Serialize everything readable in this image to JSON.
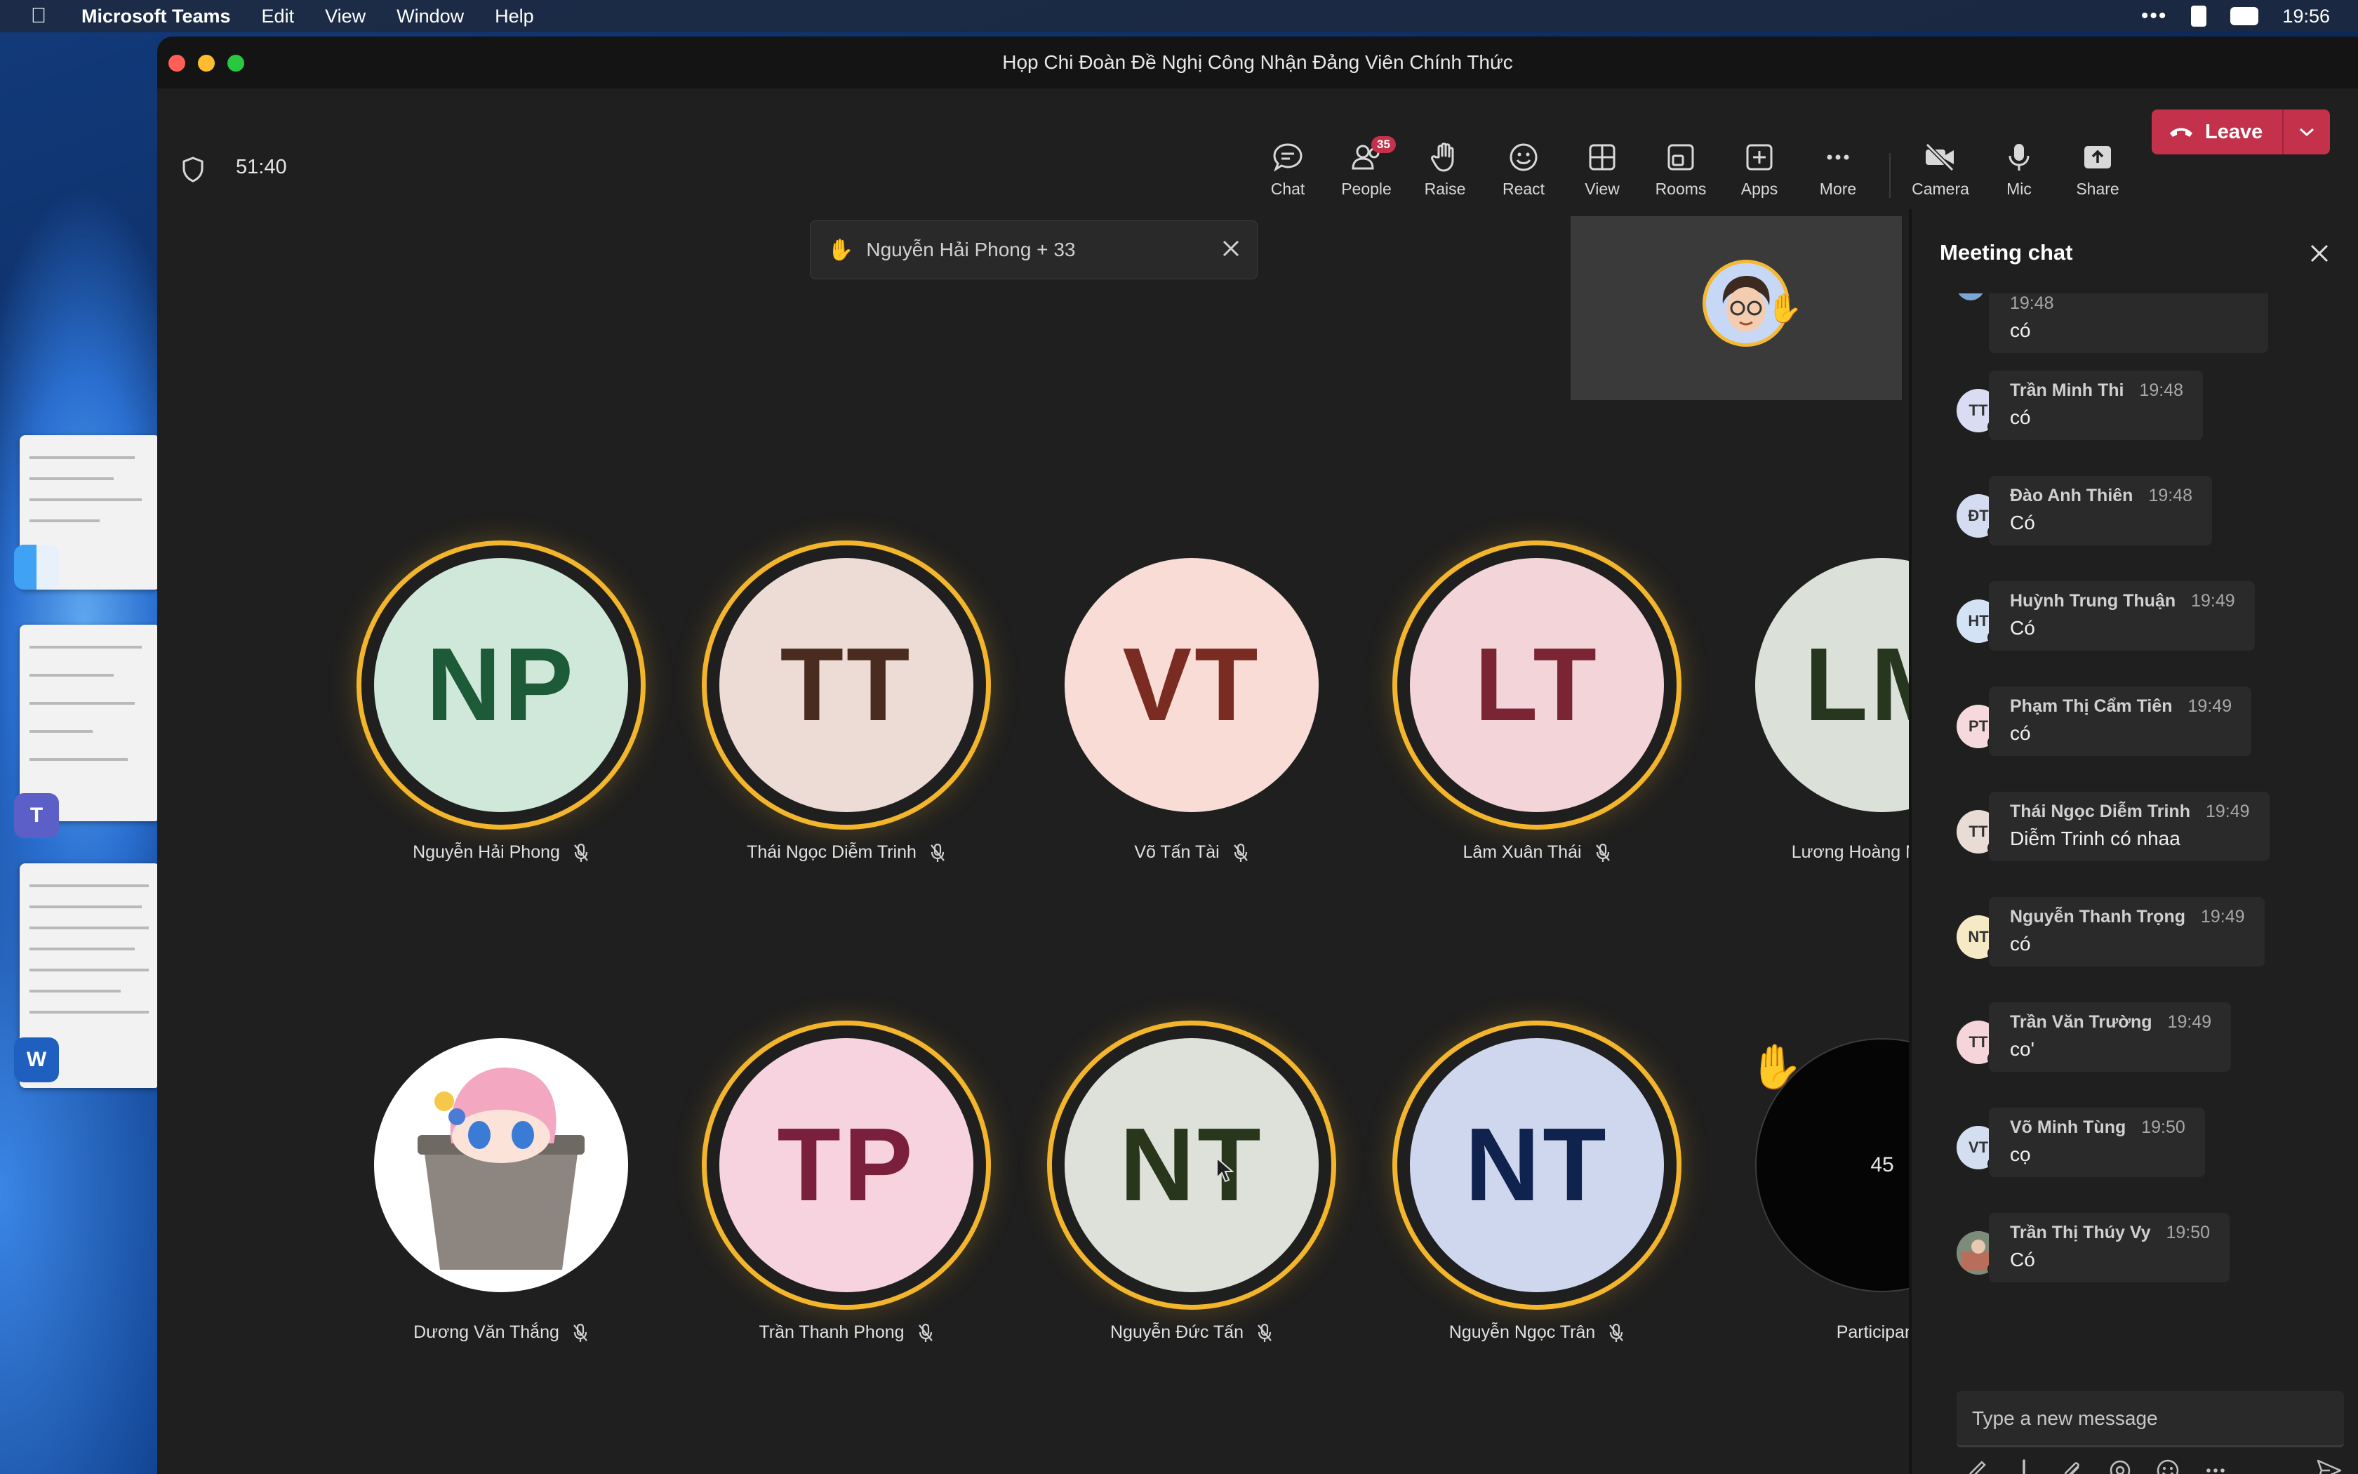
{
  "menubar": {
    "app_name": "Microsoft Teams",
    "menus": [
      "Edit",
      "View",
      "Window",
      "Help"
    ],
    "clock": "19:56"
  },
  "window": {
    "title": "Họp Chi Đoàn Đề Nghị Công Nhận Đảng Viên Chính Thức"
  },
  "toolbar": {
    "timer": "51:40",
    "chat": "Chat",
    "people": "People",
    "people_badge": "35",
    "raise": "Raise",
    "react": "React",
    "view": "View",
    "rooms": "Rooms",
    "apps": "Apps",
    "more": "More",
    "camera": "Camera",
    "mic": "Mic",
    "share": "Share",
    "leave": "Leave"
  },
  "stage": {
    "raised_hand_banner": "Nguyễn Hải Phong + 33",
    "participants_count": "45",
    "participants_label": "Participants",
    "tiles": [
      {
        "initials": "NP",
        "name": "Nguyễn Hải Phong",
        "bg": "#cfe8da",
        "fg": "#1c5a38",
        "ring": true
      },
      {
        "initials": "TT",
        "name": "Thái Ngọc Diễm Trinh",
        "bg": "#ecdcd5",
        "fg": "#4a2b1f",
        "ring": true
      },
      {
        "initials": "VT",
        "name": "Võ Tấn Tài",
        "bg": "#f9dcd6",
        "fg": "#7a2c22",
        "ring": false
      },
      {
        "initials": "LT",
        "name": "Lâm Xuân Thái",
        "bg": "#f3d4d8",
        "fg": "#7a2434",
        "ring": true
      },
      {
        "initials": "LM",
        "name": "Lương Hoàng Minh",
        "bg": "#dbe1d8",
        "fg": "#27361f",
        "ring": false
      },
      {
        "initials": "",
        "name": "Dương Văn Thắng",
        "bg": "#ffffff",
        "fg": "#000000",
        "ring": false
      },
      {
        "initials": "TP",
        "name": "Trần Thanh Phong",
        "bg": "#f6d3df",
        "fg": "#7a1f3c",
        "ring": true
      },
      {
        "initials": "NT",
        "name": "Nguyễn Đức Tấn",
        "bg": "#dde1d9",
        "fg": "#28371c",
        "ring": true
      },
      {
        "initials": "NT",
        "name": "Nguyễn Ngọc Trân",
        "bg": "#cfd7ee",
        "fg": "#10234f",
        "ring": true
      }
    ]
  },
  "chat": {
    "title": "Meeting chat",
    "compose_placeholder": "Type a new message",
    "partial_message": {
      "time": "19:48",
      "text": "có"
    },
    "messages": [
      {
        "initials": "TT",
        "name": "Trần Minh Thi",
        "time": "19:48",
        "text": "có",
        "avatar_bg": "#d9dcf2"
      },
      {
        "initials": "ĐT",
        "name": "Đào Anh Thiên",
        "time": "19:48",
        "text": "Có",
        "avatar_bg": "#d3dcf0"
      },
      {
        "initials": "HT",
        "name": "Huỳnh Trung Thuận",
        "time": "19:49",
        "text": "Có",
        "avatar_bg": "#d3e2f4"
      },
      {
        "initials": "PT",
        "name": "Phạm Thị Cẩm Tiên",
        "time": "19:49",
        "text": "có",
        "avatar_bg": "#f5d9dc"
      },
      {
        "initials": "TT",
        "name": "Thái Ngọc Diễm Trinh",
        "time": "19:49",
        "text": "Diễm Trinh có nhaa",
        "avatar_bg": "#e9dcd5"
      },
      {
        "initials": "NT",
        "name": "Nguyễn Thanh Trọng",
        "time": "19:49",
        "text": "có",
        "avatar_bg": "#f6eac6"
      },
      {
        "initials": "TT",
        "name": "Trần Văn Trường",
        "time": "19:49",
        "text": "co'",
        "avatar_bg": "#f5d4da"
      },
      {
        "initials": "VT",
        "name": "Võ Minh Tùng",
        "time": "19:50",
        "text": "cọ",
        "avatar_bg": "#d3dff0"
      },
      {
        "initials": "",
        "name": "Trần Thị Thúy Vy",
        "time": "19:50",
        "text": "Có",
        "avatar_bg": "#6b7a6a"
      }
    ]
  }
}
